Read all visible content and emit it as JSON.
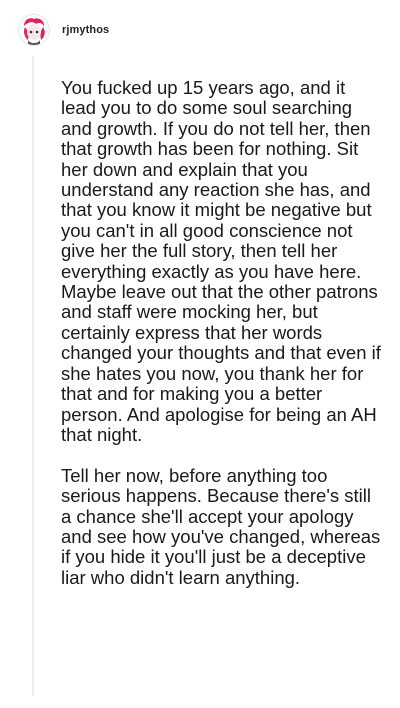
{
  "post": {
    "username": "rjmythos",
    "avatar_icon": "avatar-icon",
    "paragraphs": [
      "You fucked up 15 years ago, and it lead you to do some soul searching and growth. If you do not tell her, then that growth has been for nothing. Sit her down and explain that you understand any reaction she has, and that you know it might be negative but you can't in all good conscience not give her the full story, then tell her everything exactly as you have here. Maybe leave out that the other patrons and staff were mocking her, but certainly express that her words changed your thoughts and that even if she hates you now, you thank her for that and for making you a better person. And apologise for being an AH that night.",
      "Tell her now, before anything too serious happens. Because there's still a chance she'll accept your apology and see how you've changed, whereas if you hide it you'll just be a deceptive liar who didn't learn anything."
    ]
  },
  "colors": {
    "text": "#1a1a1a",
    "thread_line": "#ececec",
    "avatar_accent": "#e0245e"
  }
}
